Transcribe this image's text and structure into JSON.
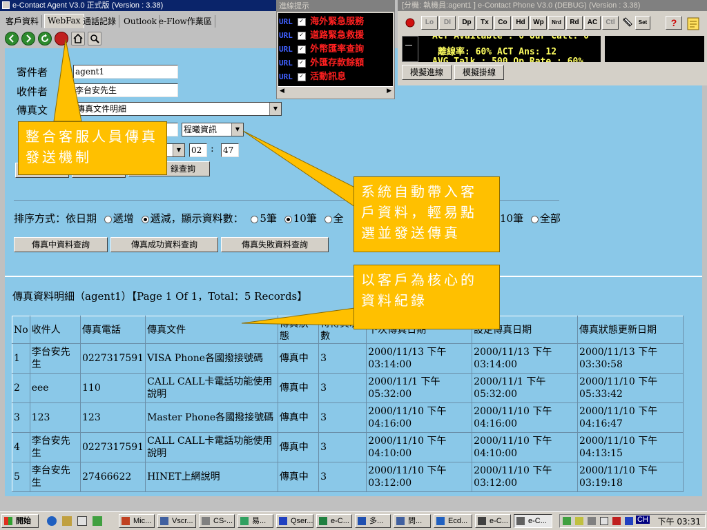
{
  "agent_window": {
    "title": "e-Contact Agent V3.0 正式版 (Version : 3.38)",
    "tabs": [
      "客戶資料",
      "WebFax",
      "通話記錄",
      "Outlook",
      "e-Flow作業區"
    ],
    "active_tab": "WebFax"
  },
  "form": {
    "sender_label": "寄件者",
    "sender_value": "agent1",
    "recipient_label": "收件者",
    "recipient_value": "李台安先生",
    "document_label": "傳真文",
    "document_value": "傳真文件明細",
    "extra_select_value": "程曦資訊",
    "time_select": "午",
    "hour": "02",
    "time_sep": ":",
    "minute": "47",
    "record_query_button": "錄查詢"
  },
  "sort": {
    "label": "排序方式：依日期",
    "asc": "遞增",
    "desc": "遞減",
    "count_label": "，顯示資料數：",
    "opt5": "5筆",
    "opt10": "10筆",
    "opt_hidden": "全",
    "right_10": "10筆",
    "right_all": "全部"
  },
  "query_buttons": {
    "sending": "傳真中資料查詢",
    "success": "傳真成功資料查詢",
    "failed": "傳真失敗資料查詢"
  },
  "detail": {
    "heading": "傳真資料明細（agent1）【Page 1 Of 1，Total：5 Records】",
    "columns": [
      "No",
      "收件人",
      "傳真電話",
      "傳真文件",
      "傳真狀態",
      "待傳真次數",
      "下次傳真日期",
      "設定傳真日期",
      "傳真狀態更新日期"
    ],
    "rows": [
      {
        "no": "1",
        "name": "李台安先生",
        "phone": "0227317591",
        "doc": "VISA Phone各國撥接號碼",
        "status": "傳真中",
        "count": "3",
        "next": "2000/11/13 下午 03:14:00",
        "set": "2000/11/13 下午 03:14:00",
        "updated": "2000/11/13 下午 03:30:58"
      },
      {
        "no": "2",
        "name": "eee",
        "phone": "110",
        "doc": "CALL CALL卡電話功能使用說明",
        "status": "傳真中",
        "count": "3",
        "next": "2000/11/1 下午 05:32:00",
        "set": "2000/11/1 下午 05:32:00",
        "updated": "2000/11/10 下午 05:33:42"
      },
      {
        "no": "3",
        "name": "123",
        "phone": "123",
        "doc": "Master Phone各國撥接號碼",
        "status": "傳真中",
        "count": "3",
        "next": "2000/11/10 下午 04:16:00",
        "set": "2000/11/10 下午 04:16:00",
        "updated": "2000/11/10 下午 04:16:47"
      },
      {
        "no": "4",
        "name": "李台安先生",
        "phone": "0227317591",
        "doc": "CALL CALL卡電話功能使用說明",
        "status": "傳真中",
        "count": "3",
        "next": "2000/11/10 下午 04:10:00",
        "set": "2000/11/10 下午 04:10:00",
        "updated": "2000/11/10 下午 04:13:15"
      },
      {
        "no": "5",
        "name": "李台安先生",
        "phone": "27466622",
        "doc": "HINET上網說明",
        "status": "傳真中",
        "count": "3",
        "next": "2000/11/10 下午 03:12:00",
        "set": "2000/11/10 下午 03:12:00",
        "updated": "2000/11/10 下午 03:19:18"
      }
    ]
  },
  "notice_window": {
    "title": "進線提示",
    "items": [
      {
        "tag": "URL",
        "text": "海外緊急服務"
      },
      {
        "tag": "URL",
        "text": "道路緊急救援"
      },
      {
        "tag": "URL",
        "text": "外幣匯率查詢"
      },
      {
        "tag": "URL",
        "text": "外匯存款餘額"
      },
      {
        "tag": "URL",
        "text": "活動訊息"
      }
    ]
  },
  "phone_window": {
    "title": "[分機: 執機員:agent1 ] e-Contact Phone V3.0 (DEBUG) (Version : 3.38)",
    "buttons": [
      "Lo",
      "DI",
      "Dp",
      "Tx",
      "Co",
      "Hd",
      "Wp",
      "Nrd",
      "Rd",
      "AC",
      "Ctl",
      "Set"
    ],
    "led_line1": "ACT Available : 0 Our Call: 0",
    "led_line2": "離線率: 60% ACT Ans: 12",
    "led_line3": "AVG Talk : 500 Op Rate : 60%",
    "sim_in": "模擬進線",
    "sim_hangup": "模擬掛線"
  },
  "callouts": {
    "c1": "整合客服人員傳真發送機制",
    "c2": "系統自動帶入客戶資料，輕易點選並發送傳真",
    "c3": "以客戶為核心的資料紀錄"
  },
  "taskbar": {
    "start": "開始",
    "tasks": [
      "Mic...",
      "Vscr...",
      "CS-...",
      "易...",
      "Qser...",
      "e-C...",
      "多...",
      "問...",
      "Ecd...",
      "e-C...",
      "e-C..."
    ],
    "tray_ime": "CH",
    "clock": "下午 03:31"
  },
  "colors": {
    "content_bg": "#8ac8e8",
    "callout": "#ffc000",
    "titlebar": "#0a246a"
  }
}
